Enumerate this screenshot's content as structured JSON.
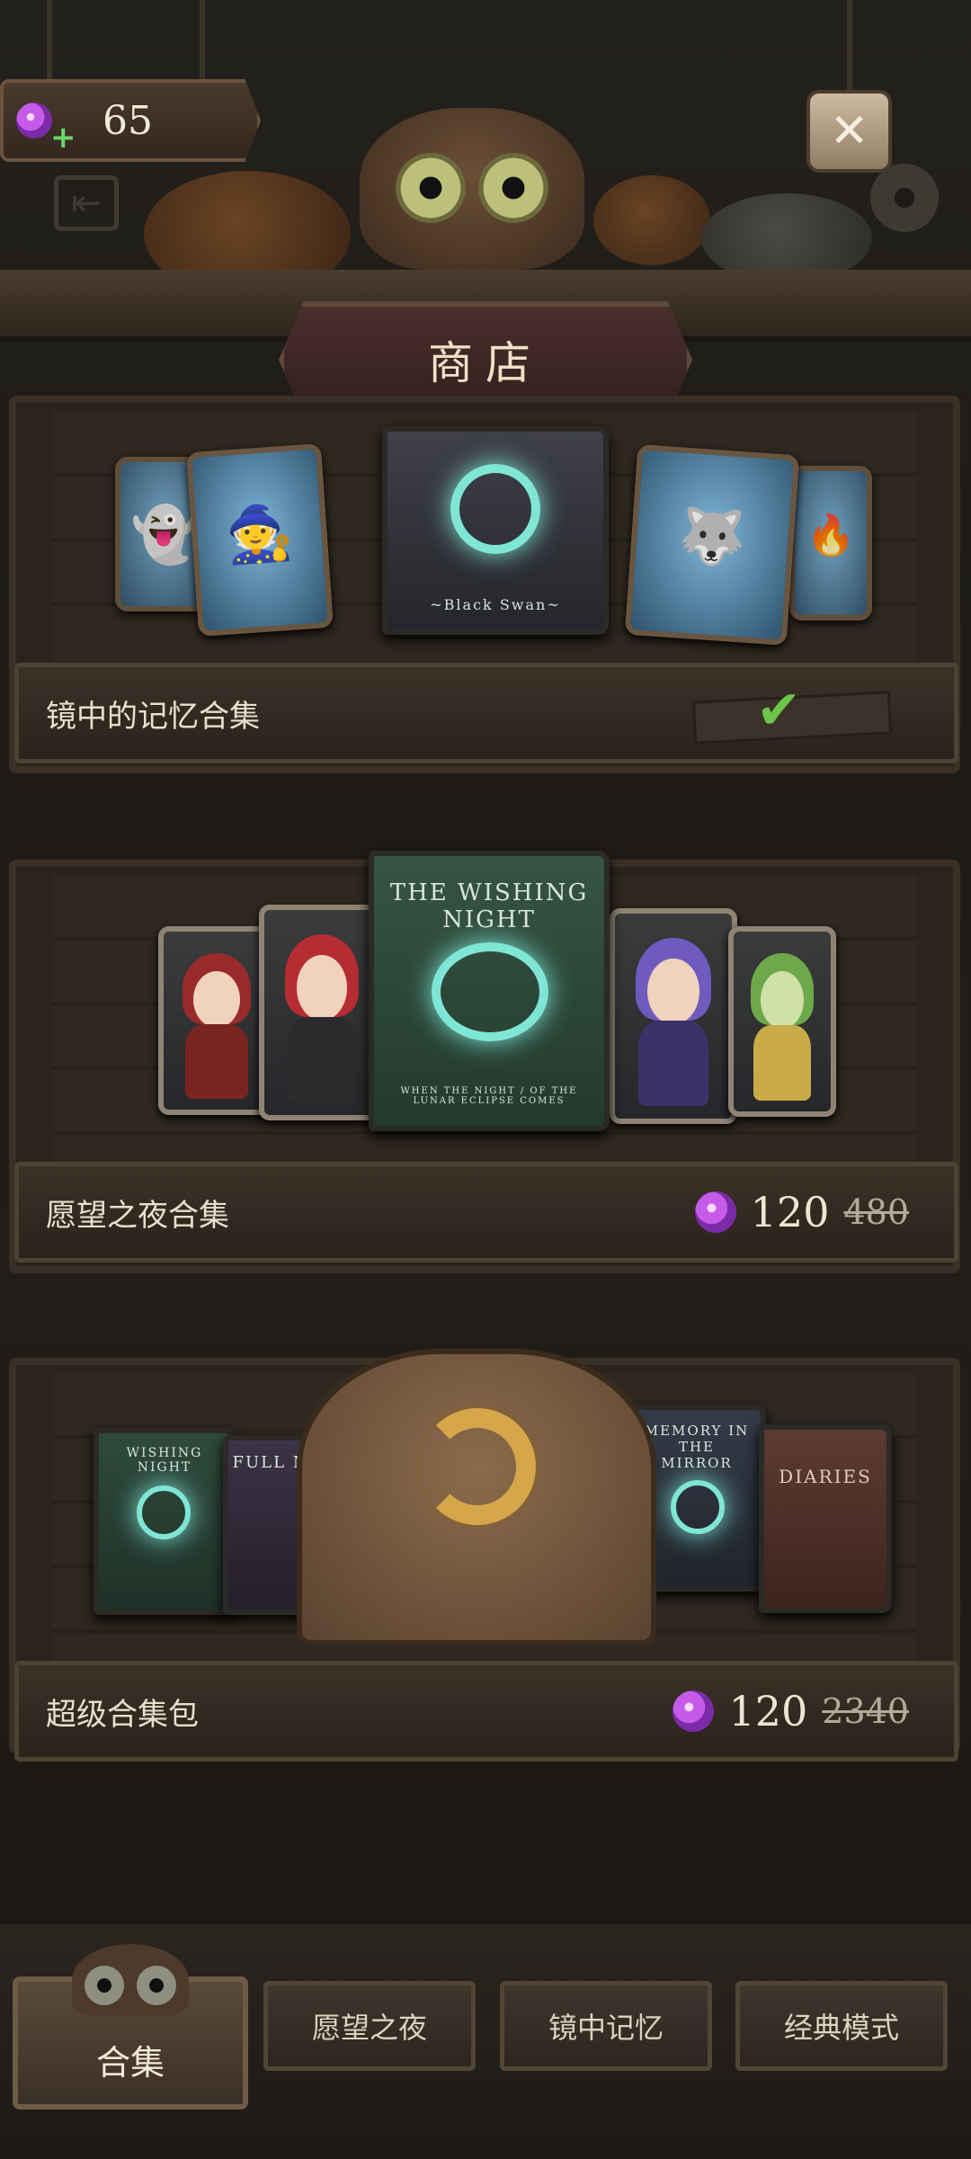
{
  "header": {
    "currency_value": "65",
    "title": "商店",
    "icons": [
      "candy-plus-icon",
      "close-icon",
      "exit-icon",
      "gear-icon"
    ]
  },
  "shelves": [
    {
      "name": "镜中的记忆合集",
      "owned": true,
      "book_title": "~Black Swan~"
    },
    {
      "name": "愿望之夜合集",
      "price": "120",
      "original_price": "480",
      "book_title": "THE WISHING NIGHT",
      "book_subtitle": "WHEN THE NIGHT / OF THE LUNAR ECLIPSE COMES"
    },
    {
      "name": "超级合集包",
      "price": "120",
      "original_price": "2340",
      "books": [
        "WISHING NIGHT",
        "FULL MOON",
        "MEMORY IN THE MIRROR",
        "DIARIES"
      ]
    }
  ],
  "tabs": {
    "active": "合集",
    "items": [
      "愿望之夜",
      "镜中记忆",
      "经典模式"
    ]
  },
  "colors": {
    "accent_candy": "#c55be8",
    "owned_check": "#6cc649",
    "glow": "#7fe6d6"
  }
}
